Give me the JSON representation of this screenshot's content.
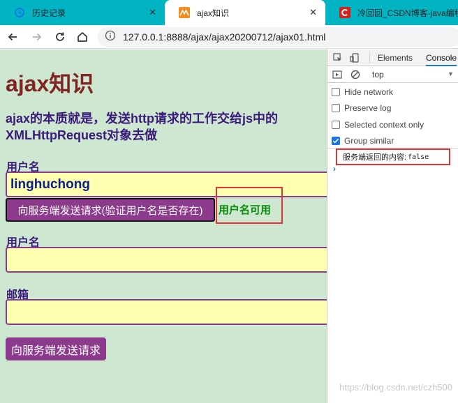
{
  "tabs": [
    {
      "title": "历史记录",
      "icon": "history-icon"
    },
    {
      "title": "ajax知识",
      "icon": "page-favicon"
    },
    {
      "title": "冷回回_CSDN博客-java编程,",
      "icon": "csdn-favicon"
    }
  ],
  "toolbar": {
    "url": "127.0.0.1:8888/ajax/ajax20200712/ajax01.html"
  },
  "page": {
    "title": "ajax知识",
    "description": "ajax的本质就是，发送http请求的工作交给js中的XMLHttpRequest对象去做",
    "username_label_1": "用户名",
    "username_value_1": "linghuchong",
    "verify_button": "向服务端发送请求(验证用户名是否存在)",
    "availability_text": "用户名可用",
    "username_label_2": "用户名",
    "username_value_2": "",
    "email_label": "邮箱",
    "email_value": "",
    "send_button": "向服务端发送请求"
  },
  "devtools": {
    "tabs": [
      "Elements",
      "Console"
    ],
    "context": "top",
    "options": [
      {
        "label": "Hide network",
        "checked": false
      },
      {
        "label": "Preserve log",
        "checked": false
      },
      {
        "label": "Selected context only",
        "checked": false
      },
      {
        "label": "Group similar",
        "checked": true
      }
    ],
    "console_message": "服务端返回的内容:",
    "console_value": "false",
    "prompt": "›"
  },
  "watermark": "https://blog.csdn.net/czh500",
  "colors": {
    "tab_strip": "#00b4c4",
    "page_bg": "#cde7d0",
    "field_bg": "#ffffb0",
    "button_bg": "#8b3a8c",
    "title_color": "#802424",
    "highlight": "#e53333"
  }
}
